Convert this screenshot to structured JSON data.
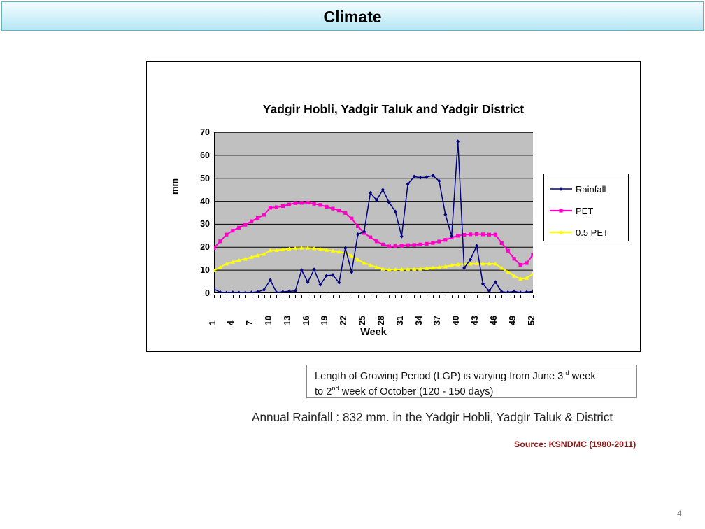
{
  "header": {
    "title": "Climate"
  },
  "legend": {
    "items": [
      {
        "label": "Rainfall",
        "color": "#000080",
        "marker": "diamond"
      },
      {
        "label": "PET",
        "color": "#FF00C8",
        "marker": "square"
      },
      {
        "label": "0.5 PET",
        "color": "#FFFF00",
        "marker": "triangle"
      }
    ]
  },
  "lgp_box": {
    "line1_a": "Length of Growing Period (LGP) is varying from June 3",
    "line1_sup": "rd",
    "line1_b": " week",
    "line2_a": "to 2",
    "line2_sup": "nd",
    "line2_b": " week of October (120 - 150 days)"
  },
  "annual_rainfall": "Annual Rainfall : 832 mm. in the Yadgir Hobli, Yadgir Taluk & District",
  "source_note": "Source: KSNDMC (1980-2011)",
  "page_number": "4",
  "chart_data": {
    "type": "line",
    "title": "Yadgir Hobli, Yadgir Taluk and Yadgir District",
    "xlabel": "Week",
    "ylabel": "mm",
    "ylim": [
      0,
      70
    ],
    "ytick_step": 10,
    "yticks": [
      0,
      10,
      20,
      30,
      40,
      50,
      60,
      70
    ],
    "xlim": [
      1,
      52
    ],
    "xticks": [
      1,
      4,
      7,
      10,
      13,
      16,
      19,
      22,
      25,
      28,
      31,
      34,
      37,
      40,
      43,
      46,
      49,
      52
    ],
    "x": [
      1,
      2,
      3,
      4,
      5,
      6,
      7,
      8,
      9,
      10,
      11,
      12,
      13,
      14,
      15,
      16,
      17,
      18,
      19,
      20,
      21,
      22,
      23,
      24,
      25,
      26,
      27,
      28,
      29,
      30,
      31,
      32,
      33,
      34,
      35,
      36,
      37,
      38,
      39,
      40,
      41,
      42,
      43,
      44,
      45,
      46,
      47,
      48,
      49,
      50,
      51,
      52
    ],
    "grid": true,
    "plot_bg": "#C0C0C0",
    "legend_position": "right",
    "series": [
      {
        "name": "Rainfall",
        "color": "#000080",
        "marker": "diamond",
        "values": [
          1.8,
          0.4,
          0.2,
          0.3,
          0.2,
          0.2,
          0.3,
          0.6,
          1.5,
          5.7,
          0.3,
          0.6,
          0.8,
          1.0,
          10.0,
          4.8,
          10.3,
          3.7,
          7.6,
          7.9,
          4.6,
          19.6,
          9.2,
          25.6,
          26.8,
          43.6,
          40.5,
          45.0,
          39.5,
          35.5,
          24.7,
          47.5,
          50.7,
          50.3,
          50.5,
          51.2,
          48.8,
          34.2,
          24.8,
          66.0,
          11.0,
          14.6,
          20.6,
          4.0,
          1.0,
          4.8,
          0.6,
          0.4,
          0.8,
          0.3,
          0.5,
          0.8
        ]
      },
      {
        "name": "PET",
        "color": "#FF00C8",
        "marker": "square",
        "values": [
          19.7,
          22.6,
          25.5,
          27.2,
          28.5,
          29.8,
          31.3,
          32.7,
          34.1,
          37.2,
          37.4,
          37.9,
          38.6,
          39.2,
          39.3,
          39.4,
          38.9,
          38.4,
          37.6,
          36.8,
          36.0,
          34.9,
          32.5,
          29.1,
          26.2,
          24.3,
          22.6,
          21.2,
          20.4,
          20.5,
          20.7,
          20.9,
          21.0,
          21.2,
          21.5,
          21.9,
          22.5,
          23.2,
          24.2,
          25.0,
          25.4,
          25.6,
          25.7,
          25.6,
          25.5,
          25.5,
          21.8,
          18.5,
          15.0,
          12.3,
          13.1,
          16.8
        ]
      },
      {
        "name": "0.5 PET",
        "color": "#FFFF00",
        "marker": "triangle",
        "values": [
          9.9,
          11.3,
          12.8,
          13.6,
          14.3,
          14.9,
          15.7,
          16.4,
          17.1,
          18.6,
          18.7,
          19.0,
          19.3,
          19.6,
          19.7,
          19.7,
          19.5,
          19.2,
          18.8,
          18.4,
          18.0,
          17.5,
          16.3,
          14.6,
          13.1,
          12.2,
          11.3,
          10.6,
          10.2,
          10.3,
          10.4,
          10.5,
          10.5,
          10.6,
          10.8,
          11.0,
          11.3,
          11.6,
          12.1,
          12.5,
          12.7,
          12.8,
          12.9,
          12.8,
          12.8,
          12.8,
          10.9,
          9.3,
          7.5,
          6.2,
          6.6,
          8.4
        ]
      }
    ]
  }
}
